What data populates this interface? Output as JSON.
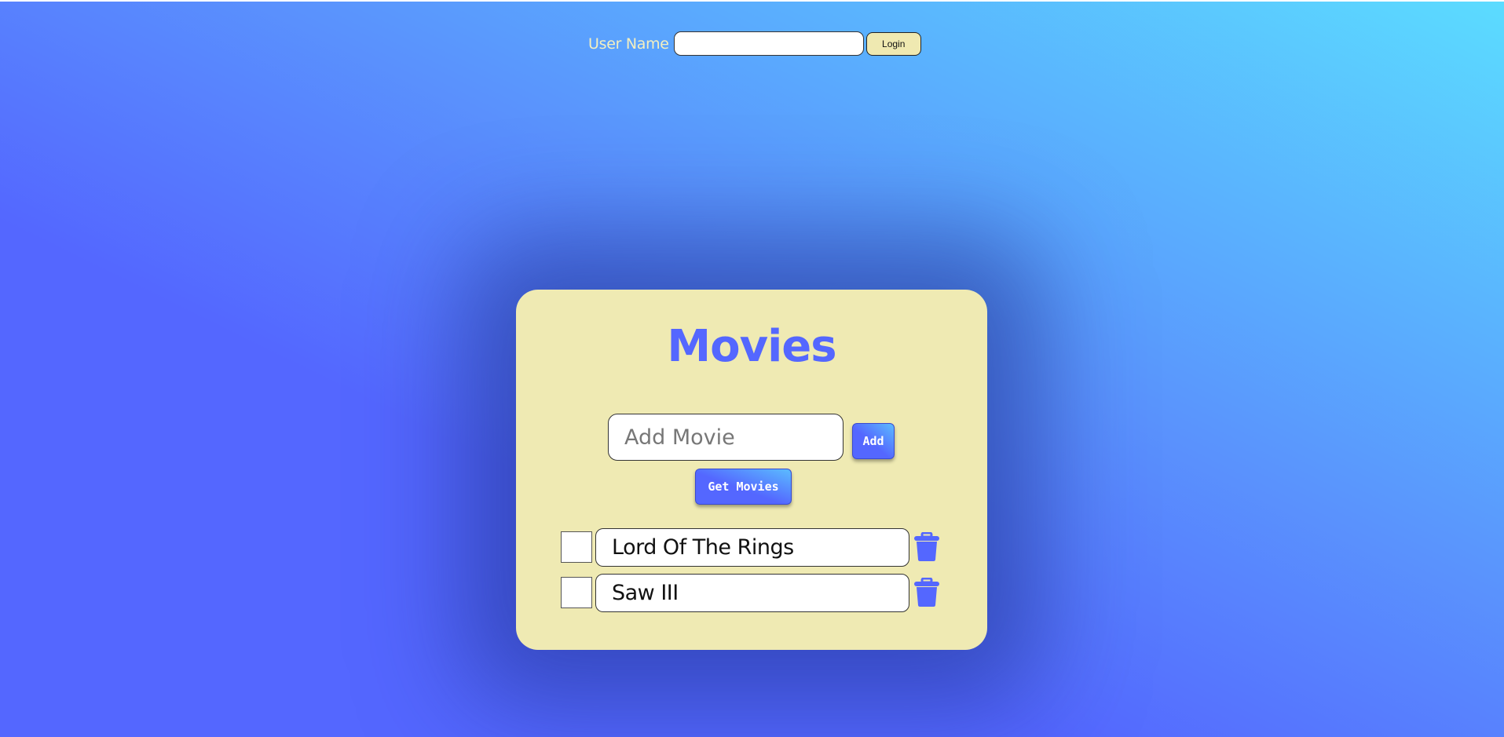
{
  "colors": {
    "accent": "#5467ff",
    "card_background": "#efeab3",
    "gradient_light": "#5bdcff"
  },
  "login": {
    "label": "User Name",
    "input_value": "",
    "button_label": "Login"
  },
  "card": {
    "title": "Movies",
    "add_input_placeholder": "Add Movie",
    "add_button_label": "Add",
    "get_button_label": "Get Movies"
  },
  "movies": [
    {
      "title": "Lord Of The Rings",
      "checked": false,
      "delete_icon": "trash-icon"
    },
    {
      "title": "Saw III",
      "checked": false,
      "delete_icon": "trash-icon"
    }
  ]
}
